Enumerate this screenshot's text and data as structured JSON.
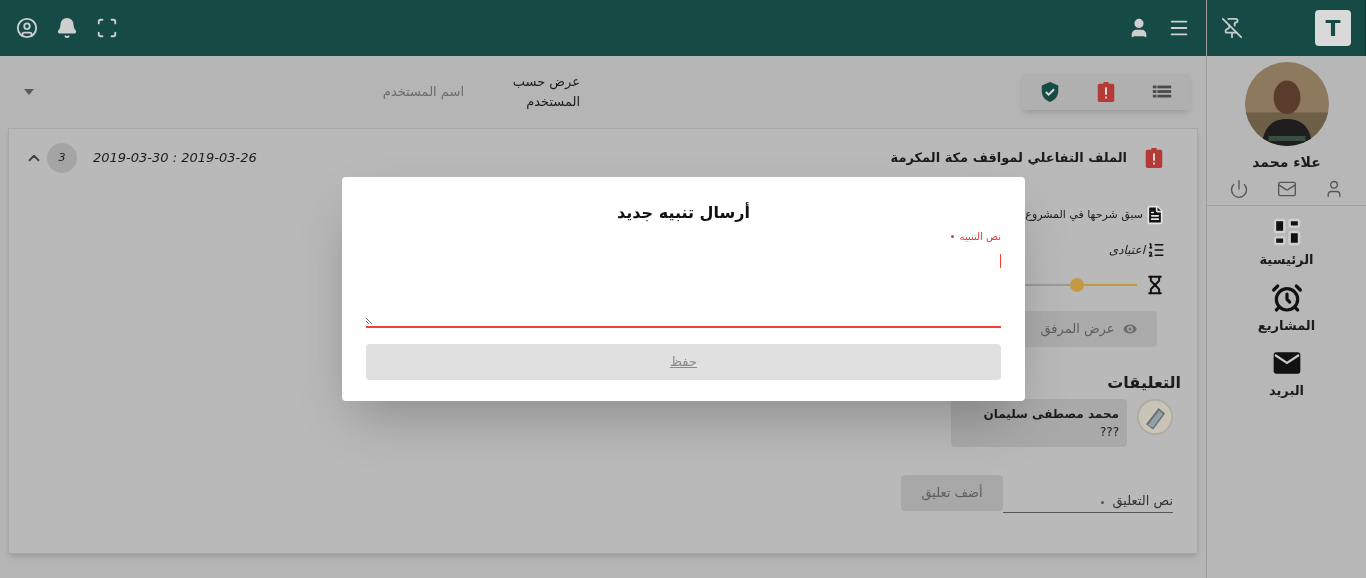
{
  "sidebar": {
    "logo": "T",
    "user": {
      "name": "علاء محمد"
    },
    "nav": [
      {
        "kind": "dashboard",
        "label": "الرئيسية"
      },
      {
        "kind": "alarm",
        "label": "المشاريع"
      },
      {
        "kind": "mail",
        "label": "البريد"
      }
    ]
  },
  "filter": {
    "label": "عرض حسب المستخدم",
    "placeholder": "اسم المستخدم"
  },
  "card": {
    "title": "الملف التفاعلي لمواقف مكة المكرمة",
    "dates": "2019-03-30 : 2019-03-26",
    "count": "3",
    "expanded": true,
    "description": "سبق شرحها في المشروع",
    "priority": "اعتيادى",
    "progress": {
      "level": 0.15
    },
    "attachment_button": {
      "label": "عرض المرفق",
      "disabled": true
    },
    "comments_title": "التعليقات",
    "comments": [
      {
        "author": "محمد مصطفى سليمان",
        "text": "???"
      }
    ],
    "comment_field": {
      "placeholder": "نص التعليق",
      "required": true
    },
    "add_button": {
      "label": "أضف تعليق",
      "disabled": true
    }
  },
  "dialog": {
    "title": "أرسال تنبيه جديد",
    "field": {
      "label": "نص التنبيه",
      "required": true,
      "invalid": true
    },
    "save_button": {
      "label": "حفظ",
      "disabled": true
    }
  }
}
